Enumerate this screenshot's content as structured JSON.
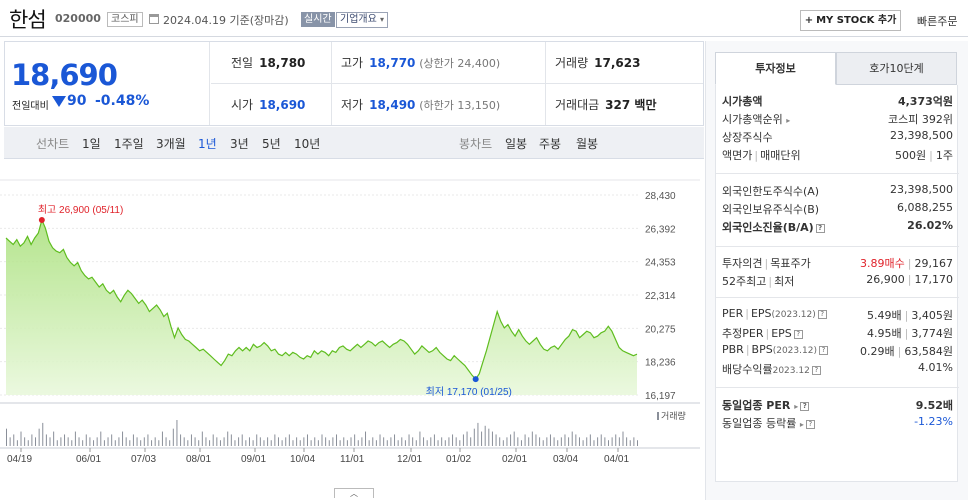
{
  "header": {
    "name": "한섬",
    "code": "020000",
    "market": "코스피",
    "date_basis": "2024.04.19 기준(장마감)",
    "realtime": "실시간",
    "corp_info": "기업개요",
    "mystock": "MY STOCK 추가",
    "quick_order": "빠른주문"
  },
  "price": {
    "current": "18,690",
    "change_label": "전일대비",
    "change": "90",
    "change_pct": "-0.48%",
    "prev_label": "전일",
    "prev": "18,780",
    "high_label": "고가",
    "high": "18,770",
    "upper_limit": "(상한가 24,400)",
    "volume_label": "거래량",
    "volume": "17,623",
    "open_label": "시가",
    "open": "18,690",
    "low_label": "저가",
    "low": "18,490",
    "lower_limit": "(하한가 13,150)",
    "amount_label": "거래대금",
    "amount": "327 백만"
  },
  "chart_tabs": {
    "line_label": "선차트",
    "periods": [
      "1일",
      "1주일",
      "3개월",
      "1년",
      "3년",
      "5년",
      "10년"
    ],
    "active": "1년",
    "candle_label": "봉차트",
    "candle_periods": [
      "일봉",
      "주봉",
      "월봉"
    ]
  },
  "chart_data": {
    "type": "area",
    "x_tick_labels": [
      "04/19",
      "06/01",
      "07/03",
      "08/01",
      "09/01",
      "10/04",
      "11/01",
      "12/01",
      "01/02",
      "02/01",
      "03/04",
      "04/01"
    ],
    "y_tick_labels": [
      "28,430",
      "26,392",
      "24,353",
      "22,314",
      "20,275",
      "18,236",
      "16,197"
    ],
    "ylim": [
      16197,
      28430
    ],
    "annotations": {
      "high": "최고 26,900 (05/11)",
      "low": "최저 17,170 (01/25)"
    },
    "volume_legend": "거래량",
    "values": [
      25800,
      25600,
      25400,
      25700,
      25300,
      25500,
      25900,
      25400,
      25800,
      26100,
      26900,
      26400,
      25600,
      25200,
      25000,
      24900,
      25100,
      24600,
      24300,
      24100,
      24300,
      23800,
      23500,
      23300,
      23400,
      23100,
      22800,
      23000,
      22600,
      22400,
      22600,
      22200,
      21900,
      22300,
      22600,
      22400,
      22100,
      21800,
      22000,
      21700,
      21300,
      21500,
      21700,
      21400,
      21000,
      21200,
      20400,
      19700,
      20300,
      19900,
      19600,
      19500,
      19300,
      19100,
      18900,
      19000,
      18800,
      18600,
      18400,
      18200,
      18000,
      18300,
      18700,
      18600,
      18900,
      19100,
      18900,
      19100,
      18900,
      19300,
      19100,
      19200,
      19400,
      19200,
      18900,
      19000,
      18700,
      18600,
      18800,
      18600,
      18800,
      18700,
      18500,
      18400,
      18600,
      18500,
      18900,
      18700,
      18900,
      18800,
      18600,
      18900,
      18800,
      19100,
      19200,
      19000,
      18900,
      19100,
      19300,
      19100,
      19300,
      19500,
      19400,
      19200,
      19400,
      19500,
      19300,
      19100,
      19300,
      19400,
      19600,
      19500,
      19300,
      19000,
      18700,
      18900,
      19200,
      19000,
      18800,
      18900,
      19100,
      18800,
      18600,
      18400,
      18300,
      18600,
      18400,
      18200,
      18000,
      17700,
      17400,
      17170,
      17500,
      18200,
      18900,
      19700,
      20500,
      21300,
      20700,
      20300,
      20500,
      20100,
      19800,
      20200,
      19800,
      19500,
      19300,
      19500,
      19700,
      19300,
      19000,
      18900,
      19100,
      19200,
      19000,
      19300,
      19600,
      19800,
      20200,
      20100,
      19700,
      19900,
      20100,
      20000,
      19700,
      19800,
      20000,
      20100,
      20400,
      20100,
      19600,
      19100,
      18900,
      18800,
      18700,
      18600,
      18690
    ],
    "volume": [
      6,
      3,
      4,
      2,
      5,
      3,
      2,
      4,
      3,
      6,
      8,
      4,
      3,
      5,
      2,
      3,
      4,
      3,
      2,
      5,
      3,
      2,
      4,
      3,
      2,
      3,
      5,
      2,
      3,
      4,
      2,
      3,
      5,
      3,
      2,
      4,
      3,
      2,
      3,
      4,
      2,
      3,
      2,
      5,
      3,
      2,
      6,
      9,
      4,
      3,
      2,
      4,
      3,
      2,
      5,
      3,
      2,
      4,
      3,
      2,
      3,
      5,
      4,
      2,
      3,
      4,
      2,
      3,
      2,
      4,
      3,
      2,
      3,
      2,
      4,
      3,
      2,
      3,
      4,
      2,
      3,
      2,
      3,
      4,
      2,
      3,
      2,
      4,
      3,
      2,
      3,
      4,
      2,
      3,
      2,
      3,
      4,
      2,
      3,
      5,
      2,
      3,
      2,
      4,
      3,
      2,
      3,
      4,
      2,
      3,
      2,
      4,
      3,
      2,
      5,
      3,
      2,
      3,
      4,
      2,
      3,
      2,
      3,
      4,
      3,
      2,
      4,
      5,
      3,
      6,
      8,
      5,
      7,
      6,
      5,
      4,
      3,
      2,
      3,
      4,
      5,
      3,
      2,
      4,
      3,
      5,
      4,
      3,
      2,
      3,
      4,
      3,
      2,
      3,
      4,
      3,
      5,
      4,
      3,
      2,
      3,
      4,
      2,
      3,
      4,
      3,
      2,
      3,
      4,
      3,
      5,
      3,
      2,
      3,
      2
    ]
  },
  "invest": {
    "tab_info": "투자정보",
    "tab_quote": "호가10단계",
    "rows": [
      {
        "k": "시가총액",
        "v": "4,373억원"
      },
      {
        "k": "시가총액순위",
        "v": "코스피 392위"
      },
      {
        "k": "상장주식수",
        "v": "23,398,500"
      },
      {
        "k": "액면가",
        "k2": "매매단위",
        "v": "500원",
        "v2": "1주"
      },
      {
        "k": "외국인한도주식수(A)",
        "v": "23,398,500"
      },
      {
        "k": "외국인보유주식수(B)",
        "v": "6,088,255"
      },
      {
        "k": "외국인소진율(B/A)",
        "v": "26.02%"
      },
      {
        "k": "투자의견",
        "k2": "목표주가",
        "v": "3.89매수",
        "v2": "29,167"
      },
      {
        "k": "52주최고",
        "k2": "최저",
        "v": "26,900",
        "v2": "17,170"
      },
      {
        "k": "PER",
        "k2": "EPS",
        "k3": "(2023.12)",
        "v": "5.49배",
        "v2": "3,405원"
      },
      {
        "k": "추정PER",
        "k2": "EPS",
        "v": "4.95배",
        "v2": "3,774원"
      },
      {
        "k": "PBR",
        "k2": "BPS",
        "k3": "(2023.12)",
        "v": "0.29배",
        "v2": "63,584원"
      },
      {
        "k": "배당수익률",
        "k3": "2023.12",
        "v": "4.01%"
      },
      {
        "k": "동일업종 PER",
        "v": "9.52배"
      },
      {
        "k": "동일업종 등락률",
        "v": "-1.23%"
      }
    ]
  }
}
